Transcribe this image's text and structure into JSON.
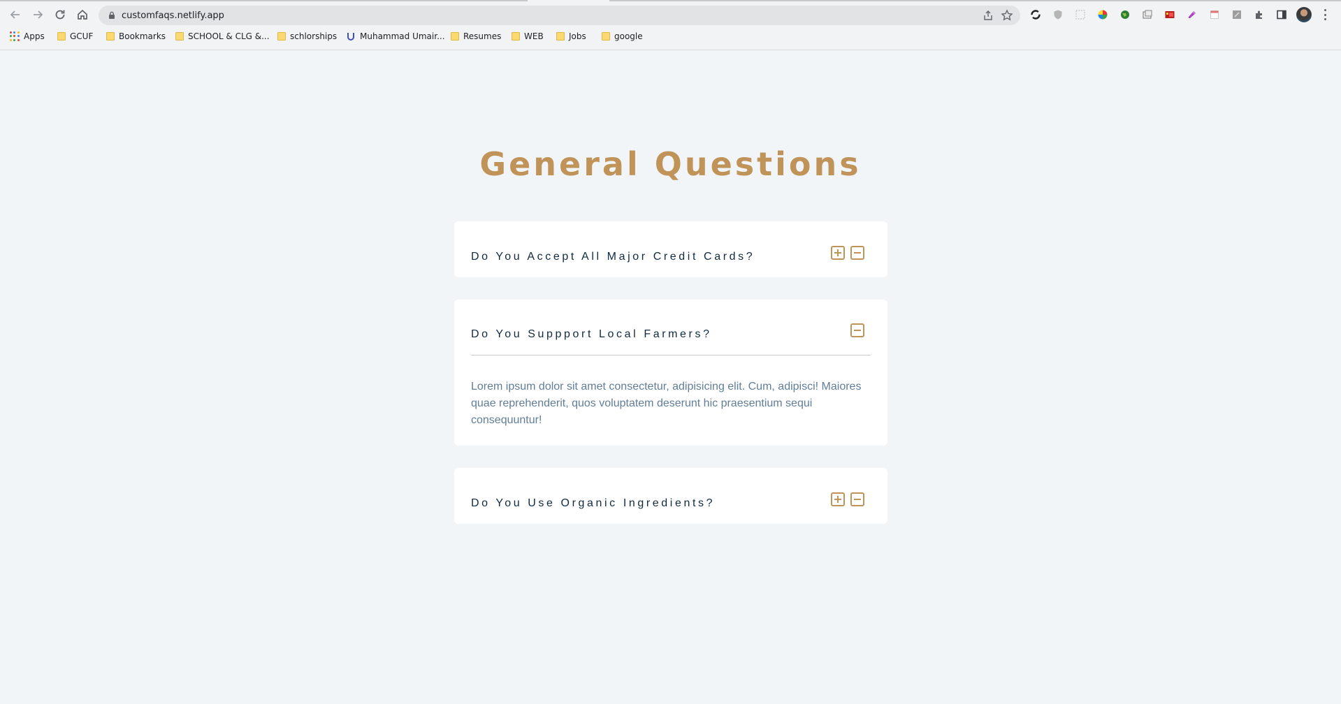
{
  "browser": {
    "url": "customfaqs.netlify.app",
    "bookmarks": [
      {
        "label": "Apps",
        "icon": "apps-grid-icon"
      },
      {
        "label": "GCUF",
        "icon": "folder-icon"
      },
      {
        "label": "Bookmarks",
        "icon": "folder-icon"
      },
      {
        "label": "SCHOOL & CLG &...",
        "icon": "folder-icon"
      },
      {
        "label": "schlorships",
        "icon": "folder-icon"
      },
      {
        "label": "Muhammad Umair...",
        "icon": "site-favicon-icon"
      },
      {
        "label": "Resumes",
        "icon": "folder-icon"
      },
      {
        "label": "WEB",
        "icon": "folder-icon"
      },
      {
        "label": "Jobs",
        "icon": "folder-icon"
      },
      {
        "label": "google",
        "icon": "folder-icon"
      }
    ]
  },
  "page": {
    "title": "General Questions",
    "accent_color": "#c09358",
    "questions": [
      {
        "question": "Do You Accept All Major Credit Cards?",
        "expanded": false
      },
      {
        "question": "Do You Suppport Local Farmers?",
        "expanded": true,
        "answer": "Lorem ipsum dolor sit amet consectetur, adipisicing elit. Cum, adipisci! Maiores quae reprehenderit, quos voluptatem deserunt hic praesentium sequi consequuntur!"
      },
      {
        "question": "Do You Use Organic Ingredients?",
        "expanded": false
      }
    ]
  }
}
